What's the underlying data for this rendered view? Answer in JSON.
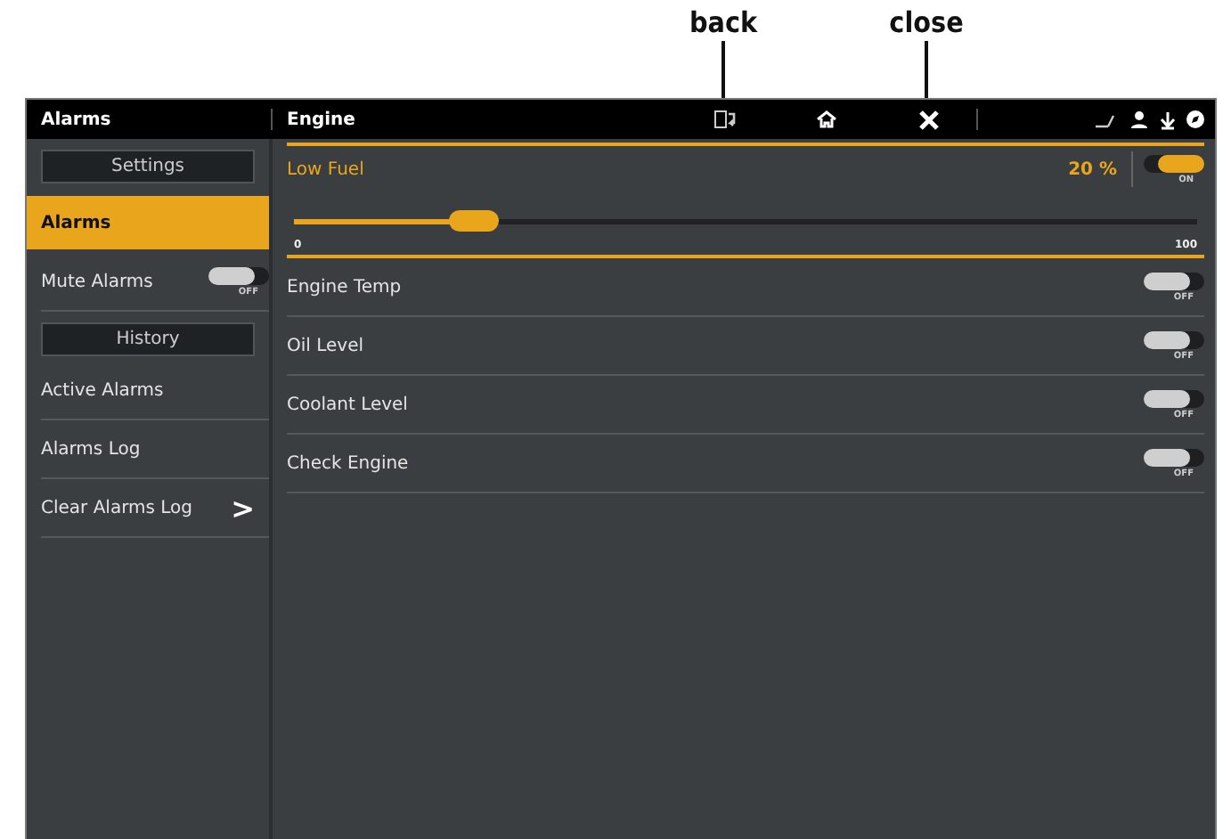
{
  "callouts": [
    {
      "label": "back"
    },
    {
      "label": "close"
    }
  ],
  "header": {
    "left_title": "Alarms",
    "title": "Engine"
  },
  "sidebar": {
    "items": [
      {
        "kind": "header",
        "label": "Settings"
      },
      {
        "kind": "item",
        "label": "Alarms",
        "selected": true
      },
      {
        "kind": "toggle",
        "label": "Mute Alarms",
        "on": false,
        "switch_label": "OFF"
      },
      {
        "kind": "header",
        "label": "History"
      },
      {
        "kind": "item",
        "label": "Active Alarms",
        "selected": false
      },
      {
        "kind": "item",
        "label": "Alarms Log",
        "selected": false
      },
      {
        "kind": "link",
        "label": "Clear Alarms Log",
        "chevron": ">"
      }
    ]
  },
  "alarms": [
    {
      "name": "Low Fuel",
      "expanded": true,
      "value": "20 %",
      "on": true,
      "switch_label": "ON",
      "level": 0.2,
      "min": "0",
      "max": "100"
    },
    {
      "name": "Engine Temp",
      "expanded": false,
      "on": false,
      "switch_label": "OFF"
    },
    {
      "name": "Oil Level",
      "expanded": false,
      "on": false,
      "switch_label": "OFF"
    },
    {
      "name": "Coolant Level",
      "expanded": false,
      "on": false,
      "switch_label": "OFF"
    },
    {
      "name": "Check Engine",
      "expanded": false,
      "on": false,
      "switch_label": "OFF"
    }
  ]
}
